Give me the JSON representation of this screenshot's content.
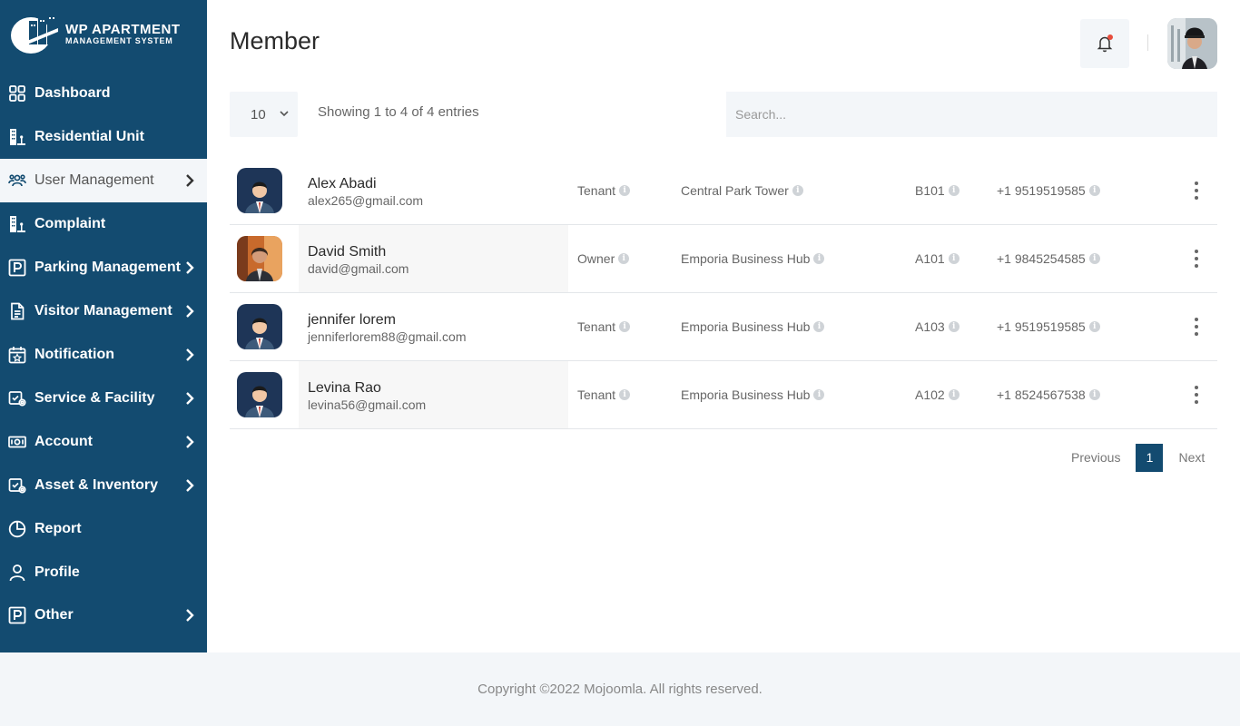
{
  "brand": {
    "title": "WP APARTMENT",
    "subtitle": "MANAGEMENT SYSTEM"
  },
  "sidebar": {
    "items": [
      {
        "label": "Dashboard",
        "icon": "grid-icon"
      },
      {
        "label": "Residential Unit",
        "icon": "building-icon"
      },
      {
        "label": "User Management",
        "icon": "users-icon",
        "active": true
      },
      {
        "label": "Complaint",
        "icon": "building-icon"
      },
      {
        "label": "Parking Management",
        "icon": "parking-icon"
      },
      {
        "label": "Visitor Management",
        "icon": "document-icon"
      },
      {
        "label": "Notification",
        "icon": "calendar-star-icon"
      },
      {
        "label": "Service & Facility",
        "icon": "service-icon"
      },
      {
        "label": "Account",
        "icon": "money-icon"
      },
      {
        "label": "Asset & Inventory",
        "icon": "service-icon"
      },
      {
        "label": "Report",
        "icon": "pie-chart-icon"
      },
      {
        "label": "Profile",
        "icon": "person-icon"
      },
      {
        "label": "Other",
        "icon": "parking-icon"
      }
    ]
  },
  "header": {
    "title": "Member"
  },
  "controls": {
    "page_length": "10",
    "info": "Showing 1 to 4 of 4 entries",
    "search_placeholder": "Search..."
  },
  "members": [
    {
      "name": "Alex Abadi",
      "email": "alex265@gmail.com",
      "role": "Tenant",
      "building": "Central Park Tower",
      "unit": "B101",
      "phone": "+1 9519519585"
    },
    {
      "name": "David Smith",
      "email": "david@gmail.com",
      "role": "Owner",
      "building": "Emporia Business Hub",
      "unit": "A101",
      "phone": "+1 9845254585"
    },
    {
      "name": "jennifer lorem",
      "email": "jenniferlorem88@gmail.com",
      "role": "Tenant",
      "building": "Emporia Business Hub",
      "unit": "A103",
      "phone": "+1 9519519585"
    },
    {
      "name": "Levina Rao",
      "email": "levina56@gmail.com",
      "role": "Tenant",
      "building": "Emporia Business Hub",
      "unit": "A102",
      "phone": "+1 8524567538"
    }
  ],
  "pagination": {
    "prev": "Previous",
    "current": "1",
    "next": "Next"
  },
  "footer": {
    "text": "Copyright ©2022 Mojoomla. All rights reserved."
  },
  "colors": {
    "sidebar": "#134b70",
    "accent": "#134b70",
    "surface": "#f3f6f9"
  }
}
